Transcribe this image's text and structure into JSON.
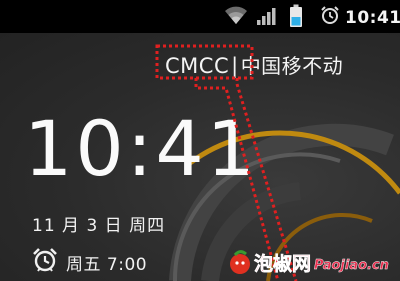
{
  "status_bar": {
    "time": "10:41",
    "icons": [
      "wifi-icon",
      "signal-icon",
      "battery-icon",
      "alarm-icon"
    ],
    "battery_color": "#2fb0e8"
  },
  "lock_screen": {
    "carrier_name": "CMCC",
    "carrier_local": "中国移不动",
    "clock": "10:41",
    "date": "11 月 3 日 周四",
    "next_alarm": "周五 7:00"
  },
  "annotation": {
    "box_color": "#e02020"
  },
  "watermark": {
    "text_cn": "泡椒网",
    "text_en": "Paojiao.cn"
  }
}
